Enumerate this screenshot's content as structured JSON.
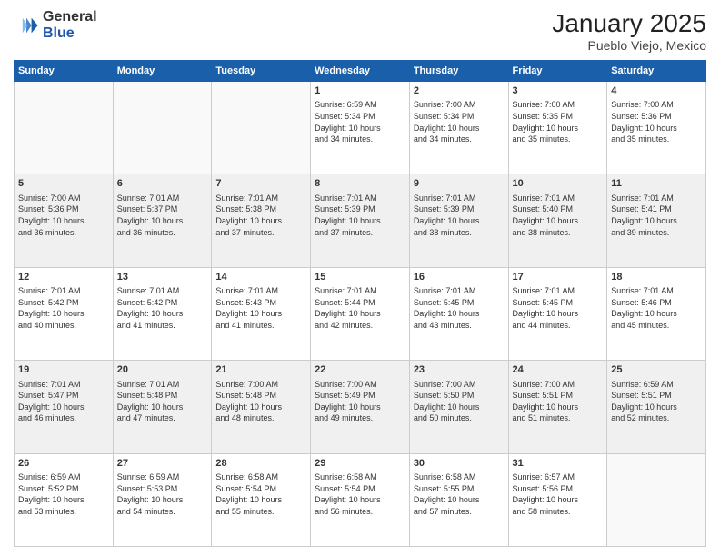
{
  "logo": {
    "general": "General",
    "blue": "Blue"
  },
  "title": "January 2025",
  "subtitle": "Pueblo Viejo, Mexico",
  "days_of_week": [
    "Sunday",
    "Monday",
    "Tuesday",
    "Wednesday",
    "Thursday",
    "Friday",
    "Saturday"
  ],
  "weeks": [
    [
      {
        "day": "",
        "info": ""
      },
      {
        "day": "",
        "info": ""
      },
      {
        "day": "",
        "info": ""
      },
      {
        "day": "1",
        "info": "Sunrise: 6:59 AM\nSunset: 5:34 PM\nDaylight: 10 hours\nand 34 minutes."
      },
      {
        "day": "2",
        "info": "Sunrise: 7:00 AM\nSunset: 5:34 PM\nDaylight: 10 hours\nand 34 minutes."
      },
      {
        "day": "3",
        "info": "Sunrise: 7:00 AM\nSunset: 5:35 PM\nDaylight: 10 hours\nand 35 minutes."
      },
      {
        "day": "4",
        "info": "Sunrise: 7:00 AM\nSunset: 5:36 PM\nDaylight: 10 hours\nand 35 minutes."
      }
    ],
    [
      {
        "day": "5",
        "info": "Sunrise: 7:00 AM\nSunset: 5:36 PM\nDaylight: 10 hours\nand 36 minutes."
      },
      {
        "day": "6",
        "info": "Sunrise: 7:01 AM\nSunset: 5:37 PM\nDaylight: 10 hours\nand 36 minutes."
      },
      {
        "day": "7",
        "info": "Sunrise: 7:01 AM\nSunset: 5:38 PM\nDaylight: 10 hours\nand 37 minutes."
      },
      {
        "day": "8",
        "info": "Sunrise: 7:01 AM\nSunset: 5:39 PM\nDaylight: 10 hours\nand 37 minutes."
      },
      {
        "day": "9",
        "info": "Sunrise: 7:01 AM\nSunset: 5:39 PM\nDaylight: 10 hours\nand 38 minutes."
      },
      {
        "day": "10",
        "info": "Sunrise: 7:01 AM\nSunset: 5:40 PM\nDaylight: 10 hours\nand 38 minutes."
      },
      {
        "day": "11",
        "info": "Sunrise: 7:01 AM\nSunset: 5:41 PM\nDaylight: 10 hours\nand 39 minutes."
      }
    ],
    [
      {
        "day": "12",
        "info": "Sunrise: 7:01 AM\nSunset: 5:42 PM\nDaylight: 10 hours\nand 40 minutes."
      },
      {
        "day": "13",
        "info": "Sunrise: 7:01 AM\nSunset: 5:42 PM\nDaylight: 10 hours\nand 41 minutes."
      },
      {
        "day": "14",
        "info": "Sunrise: 7:01 AM\nSunset: 5:43 PM\nDaylight: 10 hours\nand 41 minutes."
      },
      {
        "day": "15",
        "info": "Sunrise: 7:01 AM\nSunset: 5:44 PM\nDaylight: 10 hours\nand 42 minutes."
      },
      {
        "day": "16",
        "info": "Sunrise: 7:01 AM\nSunset: 5:45 PM\nDaylight: 10 hours\nand 43 minutes."
      },
      {
        "day": "17",
        "info": "Sunrise: 7:01 AM\nSunset: 5:45 PM\nDaylight: 10 hours\nand 44 minutes."
      },
      {
        "day": "18",
        "info": "Sunrise: 7:01 AM\nSunset: 5:46 PM\nDaylight: 10 hours\nand 45 minutes."
      }
    ],
    [
      {
        "day": "19",
        "info": "Sunrise: 7:01 AM\nSunset: 5:47 PM\nDaylight: 10 hours\nand 46 minutes."
      },
      {
        "day": "20",
        "info": "Sunrise: 7:01 AM\nSunset: 5:48 PM\nDaylight: 10 hours\nand 47 minutes."
      },
      {
        "day": "21",
        "info": "Sunrise: 7:00 AM\nSunset: 5:48 PM\nDaylight: 10 hours\nand 48 minutes."
      },
      {
        "day": "22",
        "info": "Sunrise: 7:00 AM\nSunset: 5:49 PM\nDaylight: 10 hours\nand 49 minutes."
      },
      {
        "day": "23",
        "info": "Sunrise: 7:00 AM\nSunset: 5:50 PM\nDaylight: 10 hours\nand 50 minutes."
      },
      {
        "day": "24",
        "info": "Sunrise: 7:00 AM\nSunset: 5:51 PM\nDaylight: 10 hours\nand 51 minutes."
      },
      {
        "day": "25",
        "info": "Sunrise: 6:59 AM\nSunset: 5:51 PM\nDaylight: 10 hours\nand 52 minutes."
      }
    ],
    [
      {
        "day": "26",
        "info": "Sunrise: 6:59 AM\nSunset: 5:52 PM\nDaylight: 10 hours\nand 53 minutes."
      },
      {
        "day": "27",
        "info": "Sunrise: 6:59 AM\nSunset: 5:53 PM\nDaylight: 10 hours\nand 54 minutes."
      },
      {
        "day": "28",
        "info": "Sunrise: 6:58 AM\nSunset: 5:54 PM\nDaylight: 10 hours\nand 55 minutes."
      },
      {
        "day": "29",
        "info": "Sunrise: 6:58 AM\nSunset: 5:54 PM\nDaylight: 10 hours\nand 56 minutes."
      },
      {
        "day": "30",
        "info": "Sunrise: 6:58 AM\nSunset: 5:55 PM\nDaylight: 10 hours\nand 57 minutes."
      },
      {
        "day": "31",
        "info": "Sunrise: 6:57 AM\nSunset: 5:56 PM\nDaylight: 10 hours\nand 58 minutes."
      },
      {
        "day": "",
        "info": ""
      }
    ]
  ]
}
